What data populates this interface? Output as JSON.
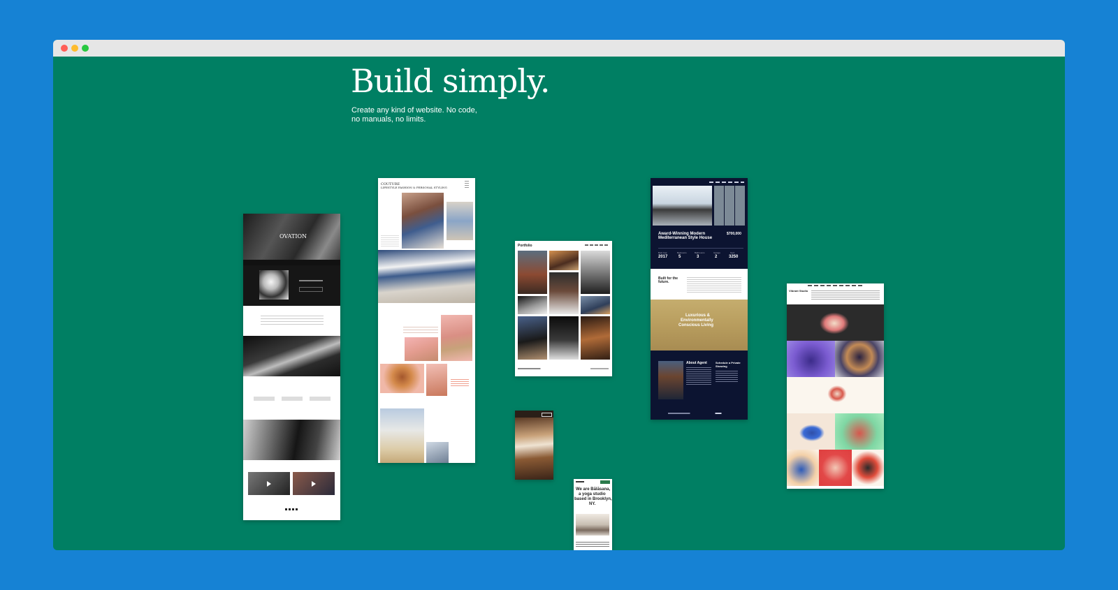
{
  "colors": {
    "page_background": "#1682d4",
    "canvas_background": "#007f63",
    "titlebar": "#e6e6e6",
    "traffic_lights": [
      "#ff5f57",
      "#febc2e",
      "#28c840"
    ]
  },
  "window": {
    "controls": [
      "close",
      "minimize",
      "maximize"
    ]
  },
  "hero": {
    "title": "Build simply.",
    "subtitle_line1": "Create any kind of website. No code,",
    "subtitle_line2": "no manuals, no limits."
  },
  "templates": {
    "ovation": {
      "name": "OVATION"
    },
    "couture": {
      "brand_line1": "COUTURE",
      "brand_line2": "LIFESTYLE FASHION & PERSONAL STYLING"
    },
    "portrait": {
      "name": "Portfolio"
    },
    "real_estate": {
      "headline_line1": "Award-Winning Modern",
      "headline_line2": "Mediterranean Style House",
      "price": "$700,000",
      "stats": [
        {
          "label": "Built Year",
          "value": "2017"
        },
        {
          "label": "Bedrooms",
          "value": "5"
        },
        {
          "label": "Bathrooms",
          "value": "3"
        },
        {
          "label": "Garage",
          "value": "2"
        },
        {
          "label": "Sq ft",
          "value": "3250"
        }
      ],
      "built_line1": "Built for the",
      "built_line2": "future.",
      "banner_line1": "Luxurious &",
      "banner_line2": "Environmentally",
      "banner_line3": "Conscious Living",
      "about_agent": "About Agent",
      "schedule_line1": "Schedule a Private",
      "schedule_line2": "Showing"
    },
    "yoga": {
      "headline_line1": "We are Bālāsana,",
      "headline_line2": "a yoga studio",
      "headline_line3": "based in Brooklyn,",
      "headline_line4": "NY."
    },
    "illustration": {
      "name": "Vibrant Studio"
    }
  }
}
